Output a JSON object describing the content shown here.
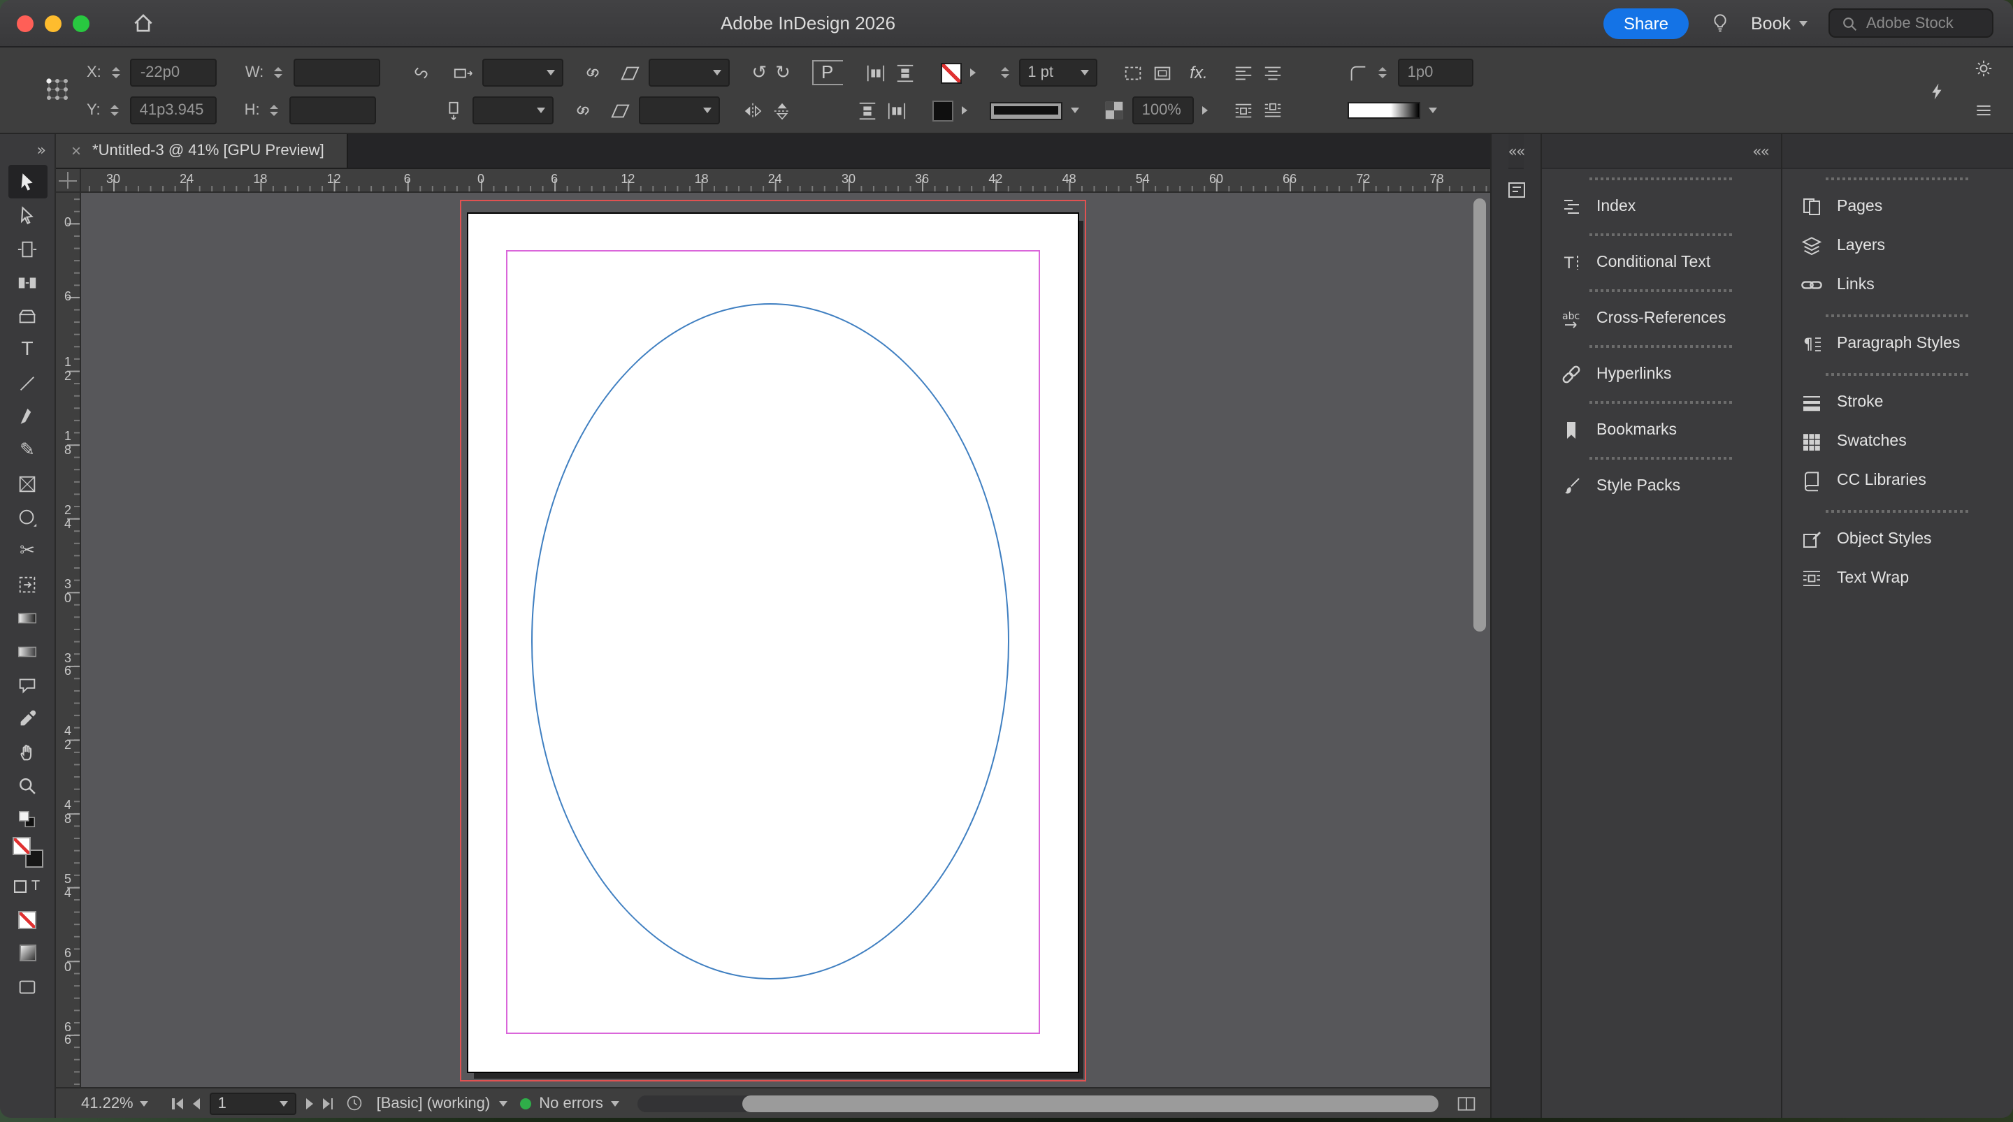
{
  "titlebar": {
    "title": "Adobe InDesign 2026",
    "share_label": "Share",
    "book_label": "Book",
    "stock_placeholder": "Adobe Stock"
  },
  "control": {
    "x_label": "X:",
    "x_value": "-22p0",
    "y_label": "Y:",
    "y_value": "41p3.945",
    "w_label": "W:",
    "w_value": "",
    "h_label": "H:",
    "h_value": "",
    "p_label": "P",
    "stroke_weight": "1 pt",
    "opacity": "100%",
    "corner_radius": "1p0",
    "fx_label": "fx."
  },
  "doc_tab": {
    "title": "*Untitled-3 @ 41% [GPU Preview]",
    "close_glyph": "×"
  },
  "tools_header": "»",
  "dock_collapse": "««",
  "ruler_h": [
    "30",
    "24",
    "18",
    "12",
    "6",
    "0",
    "6",
    "12",
    "18",
    "24",
    "30",
    "36",
    "42",
    "48",
    "54",
    "60",
    "66",
    "72",
    "78"
  ],
  "ruler_v": [
    "0",
    "6",
    "12",
    "18",
    "24",
    "30",
    "36",
    "42",
    "48",
    "54",
    "60",
    "66"
  ],
  "tools": [
    {
      "name": "selection-tool",
      "selected": true
    },
    {
      "name": "direct-selection-tool"
    },
    {
      "name": "page-tool"
    },
    {
      "name": "gap-tool"
    },
    {
      "name": "content-collector-tool"
    },
    {
      "name": "type-tool"
    },
    {
      "name": "line-tool"
    },
    {
      "name": "pen-tool"
    },
    {
      "name": "pencil-tool"
    },
    {
      "name": "rectangle-frame-tool"
    },
    {
      "name": "ellipse-tool"
    },
    {
      "name": "scissors-tool"
    },
    {
      "name": "free-transform-tool"
    },
    {
      "name": "gradient-swatch-tool"
    },
    {
      "name": "gradient-feather-tool"
    },
    {
      "name": "note-tool"
    },
    {
      "name": "eyedropper-tool"
    },
    {
      "name": "hand-tool"
    },
    {
      "name": "zoom-tool"
    },
    {
      "name": "default-fill-stroke"
    },
    {
      "name": "fill-stroke-proxy"
    },
    {
      "name": "formatting-toggles"
    },
    {
      "name": "apply-none"
    },
    {
      "name": "apply-gradient"
    },
    {
      "name": "screen-mode"
    }
  ],
  "dock1": [
    {
      "name": "panel-tab-index",
      "icon": "index-panel",
      "label": "Index"
    },
    {
      "name": "panel-tab-conditional-text",
      "icon": "conditional-text-panel",
      "label": "Conditional Text"
    },
    {
      "name": "panel-tab-cross-references",
      "icon": "cross-references-panel",
      "label": "Cross-References"
    },
    {
      "name": "panel-tab-hyperlinks",
      "icon": "hyperlinks-panel",
      "label": "Hyperlinks"
    },
    {
      "name": "panel-tab-bookmarks",
      "icon": "bookmarks-panel",
      "label": "Bookmarks"
    },
    {
      "name": "panel-tab-style-packs",
      "icon": "style-packs-panel",
      "label": "Style Packs"
    }
  ],
  "dock2": [
    {
      "name": "panel-tab-pages",
      "icon": "pages-panel",
      "label": "Pages",
      "grip": true
    },
    {
      "name": "panel-tab-layers",
      "icon": "layers-panel",
      "label": "Layers"
    },
    {
      "name": "panel-tab-links",
      "icon": "links-panel",
      "label": "Links"
    },
    {
      "name": "panel-tab-paragraph-styles",
      "icon": "paragraph-styles-panel",
      "label": "Paragraph Styles",
      "grip": true
    },
    {
      "name": "panel-tab-stroke",
      "icon": "stroke-panel",
      "label": "Stroke",
      "grip": true
    },
    {
      "name": "panel-tab-swatches",
      "icon": "swatches-panel",
      "label": "Swatches"
    },
    {
      "name": "panel-tab-cc-libraries",
      "icon": "cc-libraries-panel",
      "label": "CC Libraries"
    },
    {
      "name": "panel-tab-object-styles",
      "icon": "object-styles-panel",
      "label": "Object Styles",
      "grip": true
    },
    {
      "name": "panel-tab-text-wrap",
      "icon": "text-wrap-panel",
      "label": "Text Wrap"
    }
  ],
  "statusbar": {
    "zoom": "41.22%",
    "page": "1",
    "preflight_profile": "[Basic] (working)",
    "preflight_status": "No errors"
  },
  "colors": {
    "accent_blue": "#1473e6",
    "status_green": "#2fae49",
    "guide_margin": "#da66da",
    "guide_bleed": "#e05252",
    "shape_stroke": "#3f7fc1",
    "traffic_close": "#ff5f57",
    "traffic_min": "#febc2e",
    "traffic_max": "#28c840"
  }
}
